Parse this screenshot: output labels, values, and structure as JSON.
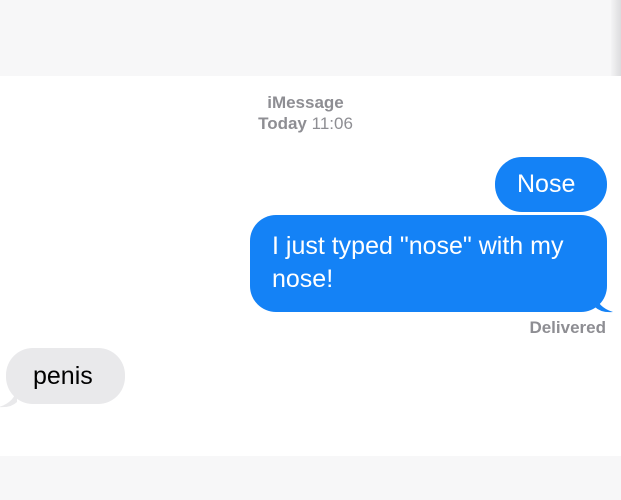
{
  "conversation": {
    "service": "iMessage",
    "day": "Today",
    "time": "11:06",
    "messages": [
      {
        "from": "me",
        "text": "Nose"
      },
      {
        "from": "me",
        "text": "I just typed \"nose\" with my nose!"
      },
      {
        "from": "them",
        "text": "penis"
      }
    ],
    "delivery_status": "Delivered"
  },
  "colors": {
    "sent_bubble": "#1482f6",
    "received_bubble": "#e9e9eb",
    "meta_text": "#8e8e93"
  }
}
